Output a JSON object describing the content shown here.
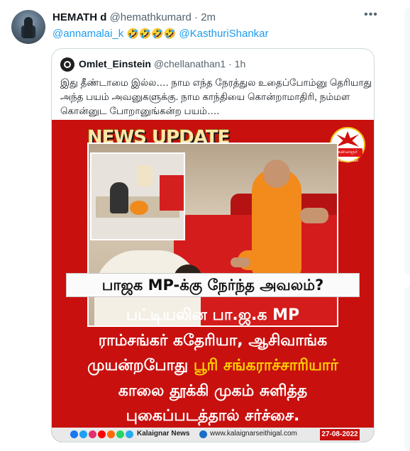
{
  "tweet": {
    "display_name": "HEMATH d",
    "handle": "@hemathkumard",
    "dot": "·",
    "time": "2m",
    "more_icon": "more-horizontal-icon",
    "reply": {
      "mention_1": "@annamalai_k",
      "emojis": "🤣🤣🤣🤣",
      "mention_2": "@KasthuriShankar"
    }
  },
  "quote": {
    "avatar_icon": "omlet-logo-icon",
    "display_name": "Omlet_Einstein",
    "handle": "@chellanathan1",
    "dot": "·",
    "time": "1h",
    "text_lines": [
      "இது தீண்டாமை இல்ல…. நாம எந்த நேரத்துல உதைப்போம்னு தெரியாது",
      "அந்த பயம் அவனுகளுக்கு. நாம காந்தியை கொன்றாமாதிரி, நம்மள",
      "கொன்னுட போறானுங்கன்ற பயம்…."
    ]
  },
  "image": {
    "news_update": "NEWS UPDATE",
    "logo_text": "கலைஞர் செய்திகள்",
    "headline": "பாஜக MP-க்கு நேர்ந்த அவலம்?",
    "body_lines": [
      {
        "white": "பட்டியலின பா.ஜ.க MP",
        "yellow": ""
      },
      {
        "white": "ராம்சங்கர் கதேரியா, ஆசிவாங்க",
        "yellow": ""
      },
      {
        "white": "முயன்றபோது ",
        "yellow": "பூரி சங்கராச்சாரியார்"
      },
      {
        "white": "காலை தூக்கி முகம் சுளித்த",
        "yellow": ""
      },
      {
        "white": "புகைப்படத்தால் சர்ச்சை.",
        "yellow": ""
      }
    ],
    "footer": {
      "brand": "Kalaignar News",
      "url": "www.kalaignarseithigal.com",
      "date": "27-08-2022"
    }
  },
  "colors": {
    "accent_link": "#1d9bf0",
    "image_red": "#c8100e",
    "highlight_yellow": "#ffd200"
  }
}
